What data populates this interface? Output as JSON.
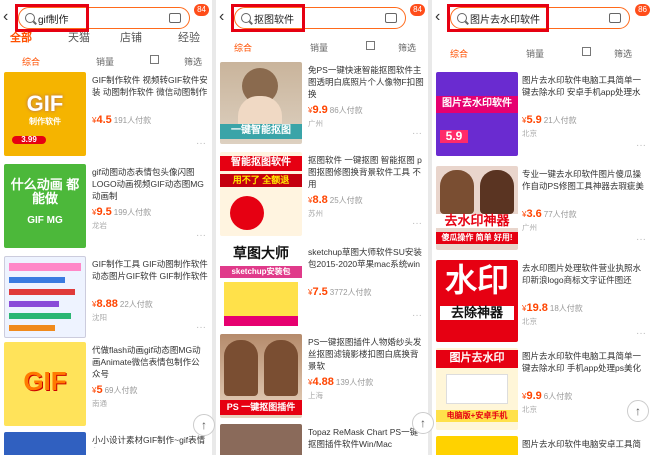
{
  "panels": [
    {
      "search": {
        "query": "gif制作",
        "badge": "84"
      },
      "tabs": [
        "全部",
        "天猫",
        "店铺",
        "经验"
      ],
      "filters": {
        "sort": "综合",
        "sales": "销量",
        "filter": "筛选"
      },
      "items": [
        {
          "thumb_text": "GIF",
          "thumb_text2": "制作软件",
          "badge": "3.99",
          "title": "GIF制作软件 视频转GIF软件安装 动图制作软件 微信动图制作",
          "price": "4.5",
          "sold": "191人付款",
          "location": ""
        },
        {
          "thumb_text": "什么动画 都能做",
          "thumb_text2": "GIF MG",
          "title": "gif动图动态表情包头像闪图LOGO动画视频GIF动态图MG动画制",
          "price": "9.5",
          "sold": "199人付款",
          "location": "龙岩"
        },
        {
          "thumb_text": "",
          "thumb_text2": "",
          "title": "GIF制作工具 GIF动图制作软件动态图片GIF软件 GIF制作软件",
          "price": "8.88",
          "sold": "22人付款",
          "location": "沈阳"
        },
        {
          "thumb_text": "GIF",
          "thumb_text2": "",
          "title": "代做flash动画gif动态图MG动画Animate微信表情包制作公众号",
          "price": "5",
          "sold": "69人付款",
          "location": "南通"
        },
        {
          "thumb_text": "",
          "thumb_text2": "",
          "title": "小小设计素材GIF制作~gif表情包",
          "price": "",
          "sold": "",
          "location": ""
        }
      ]
    },
    {
      "search": {
        "query": "抠图软件",
        "badge": "84"
      },
      "filters": {
        "sort": "综合",
        "sales": "销量",
        "filter": "筛选"
      },
      "items": [
        {
          "thumb_text": "一键智能抠图",
          "thumb_text2": "",
          "title": "免PS一键快速智能抠图软件主图透明白底照片个人像物F扣图换",
          "price": "9.9",
          "sold": "86人付款",
          "location": "广州"
        },
        {
          "thumb_text": "智能抠图软件",
          "thumb_text2": "用不了 全额退",
          "title": "抠图软件 一键抠图 智能抠图 p图抠图修图换背景软件工具 不用",
          "price": "8.8",
          "sold": "25人付款",
          "location": "苏州"
        },
        {
          "thumb_text": "草图大师",
          "thumb_text2": "sketchup安装包",
          "title": "sketchup草图大师软件SU安装包2015-2020苹果mac系统win",
          "price": "7.5",
          "sold": "3772人付款",
          "location": ""
        },
        {
          "thumb_text": "PS 一键抠图插件",
          "thumb_text2": "",
          "title": "PS一键抠图插件人物婚纱头发丝抠图滤镜影楼扣图白底换背景软",
          "price": "4.88",
          "sold": "139人付款",
          "location": "上海"
        },
        {
          "thumb_text": "",
          "thumb_text2": "",
          "title": "Topaz ReMask Chart PS一键抠图插件软件Win/Mac",
          "price": "",
          "sold": "",
          "location": ""
        }
      ]
    },
    {
      "search": {
        "query": "图片去水印软件",
        "badge": "86"
      },
      "filters": {
        "sort": "综合",
        "sales": "销量",
        "filter": "筛选"
      },
      "items": [
        {
          "thumb_text": "图片去水印软件",
          "thumb_text2": "5.9",
          "title": "图片去水印软件电脑工具简单一键去除水印 安卓手机app处理水",
          "price": "5.9",
          "sold": "21人付款",
          "location": "北京"
        },
        {
          "thumb_text": "去水印神器",
          "thumb_text2": "傻瓜操作 简单 好用!",
          "title": "专业一键去水印软件图片傻瓜操作自动PS修图工具神器去瑕疵美",
          "price": "3.6",
          "sold": "77人付款",
          "location": "广州"
        },
        {
          "thumb_text": "水印",
          "thumb_text2": "去除神器",
          "title": "去水印图片处理软件营业执照水印新浪logo商标文字证件图还",
          "price": "19.8",
          "sold": "18人付款",
          "location": "北京"
        },
        {
          "thumb_text": "图片去水印",
          "thumb_text2": "电脑版+安卓手机",
          "title": "图片去水印软件电脑工具简单一键去除水印 手机app处理ps美化",
          "price": "9.9",
          "sold": "6人付款",
          "location": "北京"
        },
        {
          "thumb_text": "",
          "thumb_text2": "",
          "title": "图片去水印软件电脑安卓工具简",
          "price": "",
          "sold": "",
          "location": ""
        }
      ]
    }
  ],
  "icons": {
    "back": "‹",
    "more": "···",
    "totop": "↑"
  },
  "colors": {
    "accent": "#ff5000",
    "highlight": "#e60012",
    "price": "#ff4400"
  }
}
